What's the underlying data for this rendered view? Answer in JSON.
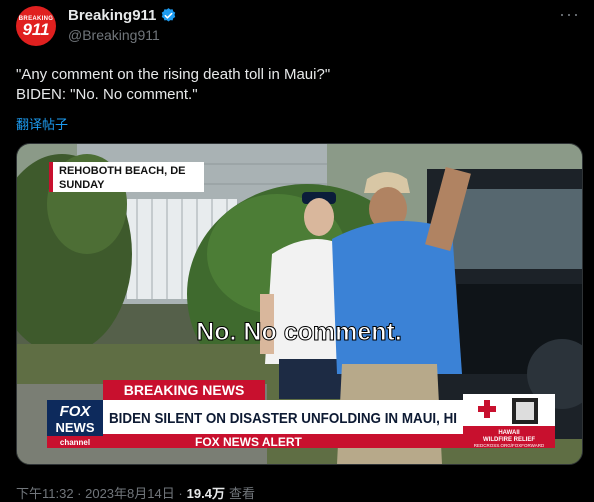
{
  "avatar": {
    "small_text": "BREAKING",
    "big_text": "911"
  },
  "author": {
    "name": "Breaking911",
    "handle": "@Breaking911"
  },
  "more_icon": "ellipsis-icon",
  "tweet": {
    "line1": "\"Any comment on the rising death toll in Maui?\"",
    "line2": "BIDEN: \"No. No comment.\"",
    "translate": "翻译帖子"
  },
  "video": {
    "location_line1": "REHOBOTH BEACH, DE",
    "location_line2": "SUNDAY",
    "caption": "No. No comment.",
    "breaking_label": "BREAKING NEWS",
    "headline": "BIDEN SILENT ON DISASTER UNFOLDING IN MAUI, HI",
    "logo_top": "FOX",
    "logo_mid": "NEWS",
    "logo_bottom": "channel",
    "alert": "FOX NEWS ALERT",
    "relief_line1": "HAWAII",
    "relief_line2": "WILDFIRE RELIEF",
    "relief_url": "REDCROSS.ORG/FOXFORWARD",
    "colors": {
      "banner_red": "#c8102e",
      "banner_blue": "#0d2a5c",
      "shirt_blue": "#3b82d6"
    }
  },
  "meta": {
    "time": "下午11:32 · 2023年8月14日 ·",
    "views": "19.4万",
    "views_label": "查看"
  }
}
